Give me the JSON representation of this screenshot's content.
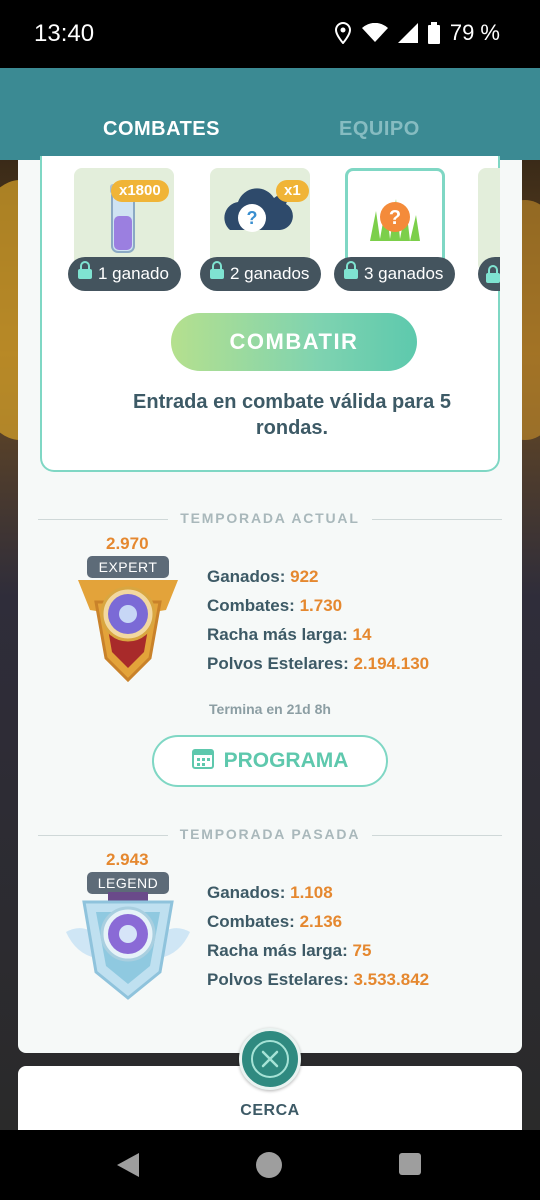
{
  "status_bar": {
    "time": "13:40",
    "battery": "79 %"
  },
  "tabs": [
    {
      "label": "COMBATES",
      "active": true
    },
    {
      "label": "EQUIPO",
      "active": false
    }
  ],
  "rewards": [
    {
      "count": "x1800",
      "label": "1 ganado",
      "icon": "stardust-vial-icon"
    },
    {
      "count": "x1",
      "label": "2 ganados",
      "icon": "mystery-cloud-icon"
    },
    {
      "count": "",
      "label": "3 ganados",
      "icon": "mystery-encounter-icon"
    },
    {
      "count": "",
      "label": "",
      "icon": "locked-reward-icon"
    }
  ],
  "entry": {
    "button_label": "COMBATIR",
    "text": "Entrada en combate válida para 5 rondas."
  },
  "current_season": {
    "header": "TEMPORADA ACTUAL",
    "rating": "2.970",
    "rank": "EXPERT",
    "stats": [
      {
        "label": "Ganados: ",
        "value": "922"
      },
      {
        "label": "Combates: ",
        "value": "1.730"
      },
      {
        "label": "Racha más larga: ",
        "value": "14"
      },
      {
        "label": "Polvos Estelares: ",
        "value": "2.194.130"
      }
    ],
    "ends": "Termina en 21d 8h",
    "schedule_label": "PROGRAMA"
  },
  "past_season": {
    "header": "TEMPORADA PASADA",
    "rating": "2.943",
    "rank": "LEGEND",
    "stats": [
      {
        "label": "Ganados: ",
        "value": "1.108"
      },
      {
        "label": "Combates: ",
        "value": "2.136"
      },
      {
        "label": "Racha más larga: ",
        "value": "75"
      },
      {
        "label": "Polvos Estelares: ",
        "value": "3.533.842"
      }
    ]
  },
  "footer": {
    "close_label": "CERCA"
  },
  "colors": {
    "accent": "#7fd7c4",
    "header": "#3b8a93",
    "value": "#e5882f",
    "text": "#3d5a66"
  }
}
